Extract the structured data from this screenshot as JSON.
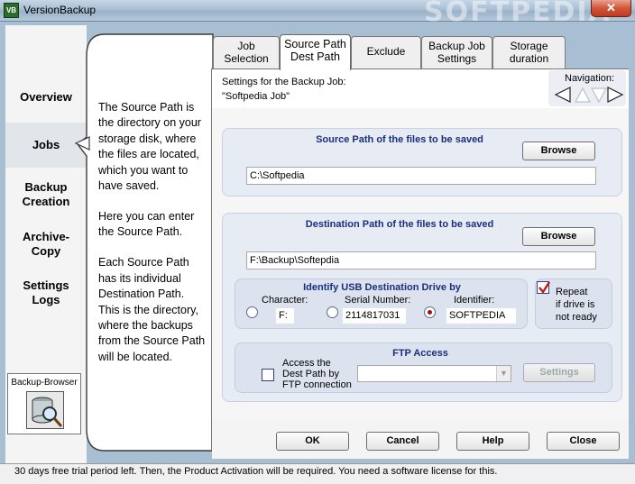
{
  "window": {
    "title": "VersionBackup",
    "icon_label": "VB",
    "close_label": "✕",
    "watermark": "SOFTPEDIA"
  },
  "nav": {
    "items": [
      {
        "id": "overview",
        "label": "Overview"
      },
      {
        "id": "jobs",
        "label": "Jobs"
      },
      {
        "id": "backup_creation",
        "label": "Backup\nCreation"
      },
      {
        "id": "archive_copy",
        "label": "Archive-\nCopy"
      },
      {
        "id": "settings_logs",
        "label": "Settings\nLogs"
      }
    ],
    "selected": "Jobs",
    "backup_browser_label": "Backup-Browser"
  },
  "help": {
    "paragraphs": [
      "The Source Path is the directory on your storage disk, where the files are located, which you want to have saved.",
      "Here you can enter the Source Path.",
      "Each Source Path has its individual Destination Path. This is the directory, where the backups from the Source Path will be located."
    ]
  },
  "tabs": [
    {
      "label": "Job\nSelection"
    },
    {
      "label": "Source Path\nDest Path",
      "active": true
    },
    {
      "label": "Exclude"
    },
    {
      "label": "Backup Job\nSettings"
    },
    {
      "label": "Storage\nduration"
    }
  ],
  "header": {
    "settings_for": "Settings for the Backup Job:",
    "job_name": "\"Softpedia Job\"",
    "navigation_label": "Navigation:"
  },
  "source": {
    "title": "Source Path of the files to be saved",
    "browse_label": "Browse",
    "path": "C:\\Softpedia"
  },
  "destination": {
    "title": "Destination Path of the files to be saved",
    "browse_label": "Browse",
    "path": "F:\\Backup\\Softepdia",
    "usb": {
      "title": "Identify USB Destination Drive by",
      "character_label": "Character:",
      "character_value": "F:",
      "serial_label": "Serial Number:",
      "serial_value": "2114817031",
      "identifier_label": "Identifier:",
      "identifier_value": "SOFTPEDIA",
      "selected": "Identifier"
    },
    "repeat": {
      "label": "Repeat\nif drive is\nnot ready",
      "checked": true
    },
    "ftp": {
      "title": "FTP Access",
      "access_label": "Access the\nDest Path by\nFTP connection",
      "access_checked": false,
      "settings_label": "Settings"
    }
  },
  "buttons": {
    "ok": "OK",
    "cancel": "Cancel",
    "help": "Help",
    "close": "Close"
  },
  "status": "30 days free trial period left. Then, the Product Activation will be required. You need a software license for this."
}
